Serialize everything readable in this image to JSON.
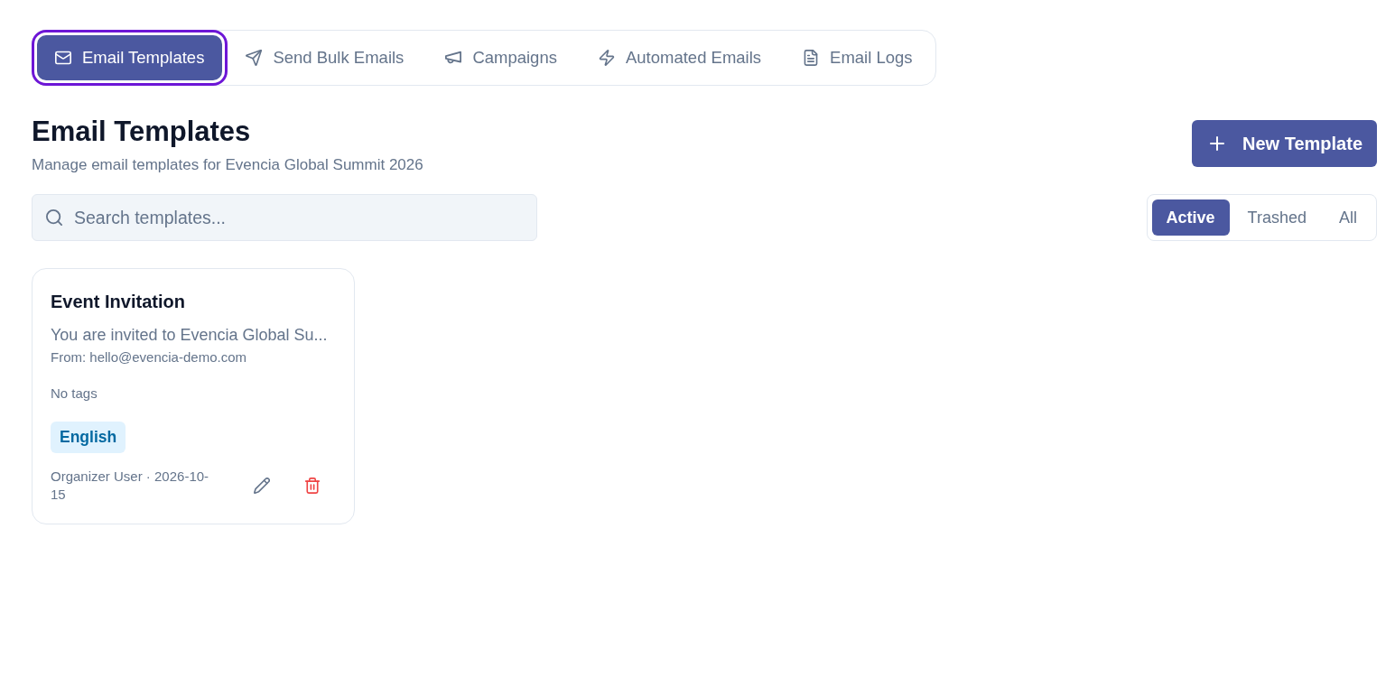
{
  "tabs": [
    {
      "label": "Email Templates",
      "selected": true,
      "focused": true
    },
    {
      "label": "Send Bulk Emails",
      "selected": false,
      "focused": false
    },
    {
      "label": "Campaigns",
      "selected": false,
      "focused": false
    },
    {
      "label": "Automated Emails",
      "selected": false,
      "focused": false
    },
    {
      "label": "Email Logs",
      "selected": false,
      "focused": false
    }
  ],
  "header": {
    "title": "Email Templates",
    "subtitle": "Manage email templates for Evencia Global Summit 2026",
    "new_button": "New Template"
  },
  "search": {
    "placeholder": "Search templates..."
  },
  "filters": [
    {
      "label": "Active",
      "selected": true
    },
    {
      "label": "Trashed",
      "selected": false
    },
    {
      "label": "All",
      "selected": false
    }
  ],
  "templates": [
    {
      "title": "Event Invitation",
      "preview": "You are invited to Evencia Global Su...",
      "from": "From: hello@evencia-demo.com",
      "tags": "No tags",
      "language": "English",
      "footer": "Organizer User · 2026-10-15"
    }
  ]
}
